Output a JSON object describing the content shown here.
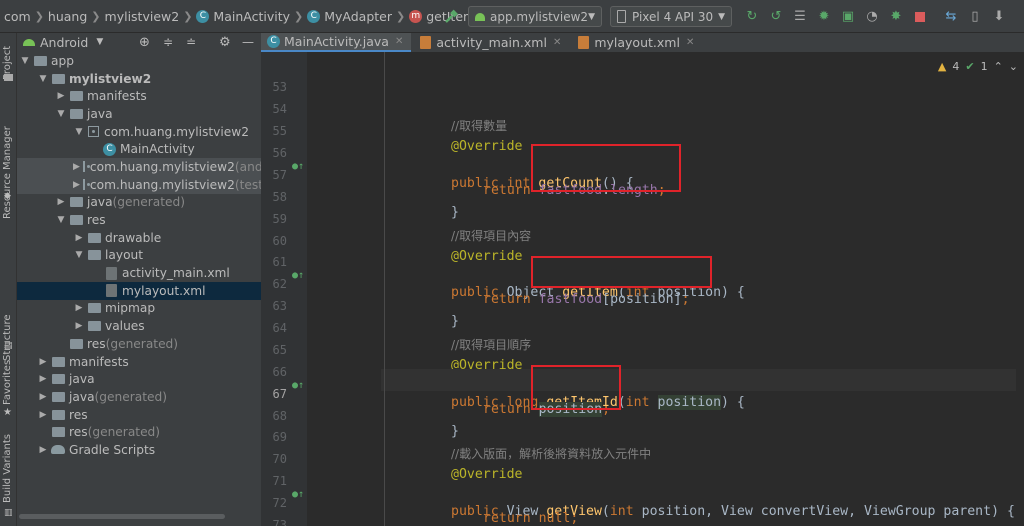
{
  "breadcrumbs": [
    "com",
    "huang",
    "mylistview2",
    "MainActivity",
    "MyAdapter",
    "getItemId"
  ],
  "toolbar": {
    "run_config": "app.mylistview2",
    "device": "Pixel 4 API 30"
  },
  "left_strip": {
    "project": "Project",
    "resource_manager": "Resource Manager",
    "structure": "Structure",
    "favorites": "Favorites",
    "build_variants": "Build Variants"
  },
  "panel": {
    "view_mode": "Android"
  },
  "tree": [
    {
      "label": "app",
      "suffix": ""
    },
    {
      "label": "mylistview2",
      "suffix": ""
    },
    {
      "label": "manifests",
      "suffix": ""
    },
    {
      "label": "java",
      "suffix": ""
    },
    {
      "label": "com.huang.mylistview2",
      "suffix": ""
    },
    {
      "label": "MainActivity",
      "suffix": ""
    },
    {
      "label": "com.huang.mylistview2",
      "suffix": " (andro"
    },
    {
      "label": "com.huang.mylistview2",
      "suffix": " (test)"
    },
    {
      "label": "java",
      "suffix": " (generated)"
    },
    {
      "label": "res",
      "suffix": ""
    },
    {
      "label": "drawable",
      "suffix": ""
    },
    {
      "label": "layout",
      "suffix": ""
    },
    {
      "label": "activity_main.xml",
      "suffix": ""
    },
    {
      "label": "mylayout.xml",
      "suffix": ""
    },
    {
      "label": "mipmap",
      "suffix": ""
    },
    {
      "label": "values",
      "suffix": ""
    },
    {
      "label": "res",
      "suffix": " (generated)"
    },
    {
      "label": "manifests",
      "suffix": ""
    },
    {
      "label": "java",
      "suffix": ""
    },
    {
      "label": "java",
      "suffix": " (generated)"
    },
    {
      "label": "res",
      "suffix": ""
    },
    {
      "label": "res",
      "suffix": " (generated)"
    },
    {
      "label": "Gradle Scripts",
      "suffix": ""
    }
  ],
  "tabs": [
    {
      "label": "MainActivity.java",
      "active": true
    },
    {
      "label": "activity_main.xml",
      "active": false
    },
    {
      "label": "mylayout.xml",
      "active": false
    }
  ],
  "inspections": {
    "warnings": "4",
    "ok": "1"
  },
  "code": {
    "l53": "53",
    "l54": "54",
    "l55": "55",
    "l56": "56",
    "l57": "57",
    "l58": "58",
    "l59": "59",
    "l60": "60",
    "l61": "61",
    "l62": "62",
    "l63": "63",
    "l64": "64",
    "l65": "65",
    "l66": "66",
    "l67": "67",
    "l68": "68",
    "l69": "69",
    "l70": "70",
    "l71": "71",
    "l72": "72",
    "l73": "73",
    "c54": "//取得數量",
    "c59": "//取得項目內容",
    "c64": "//取得項目順序",
    "c69": "//載入版面，解析後將資料放入元件中",
    "override": "@Override",
    "public": "public",
    "int": "int",
    "long": "long",
    "return": "return",
    "null": "null",
    "object": "Object",
    "view": "View",
    "viewgroup": "ViewGroup",
    "getCount": "getCount",
    "getItem": "getItem",
    "getItemId": "getItemId",
    "getView": "getView",
    "fastfood": "fastfood",
    "length": "length",
    "position": "position",
    "convertView": "convertView",
    "parent": "parent"
  }
}
